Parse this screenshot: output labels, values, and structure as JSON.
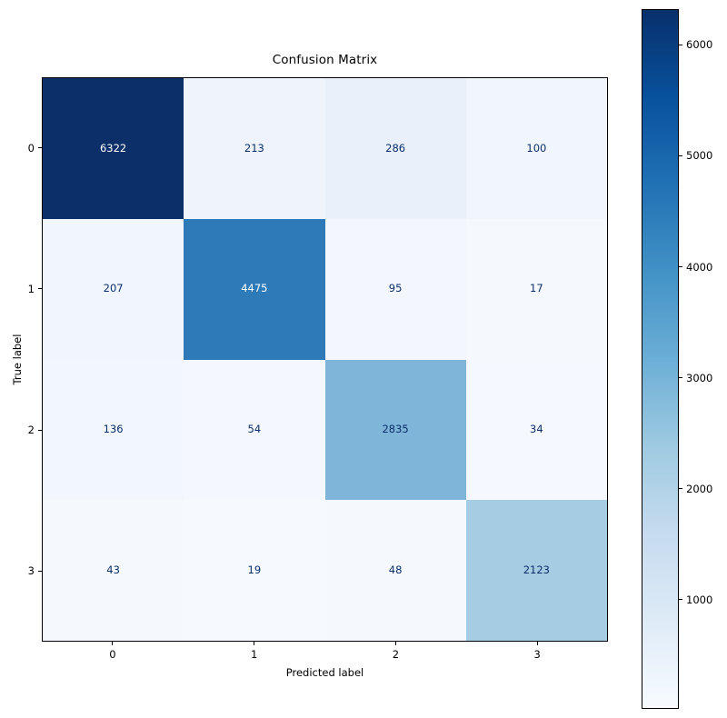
{
  "chart_data": {
    "type": "heatmap",
    "title": "Confusion Matrix",
    "xlabel": "Predicted label",
    "ylabel": "True label",
    "x_tick_labels": [
      "0",
      "1",
      "2",
      "3"
    ],
    "y_tick_labels": [
      "0",
      "1",
      "2",
      "3"
    ],
    "categories": [
      "0",
      "1",
      "2",
      "3"
    ],
    "matrix": [
      [
        6322,
        213,
        286,
        100
      ],
      [
        207,
        4475,
        95,
        17
      ],
      [
        136,
        54,
        2835,
        34
      ],
      [
        43,
        19,
        48,
        2123
      ]
    ],
    "cell_labels": [
      [
        "6322",
        "213",
        "286",
        "100"
      ],
      [
        "207",
        "4475",
        "95",
        "17"
      ],
      [
        "136",
        "54",
        "2835",
        "34"
      ],
      [
        "43",
        "19",
        "48",
        "2123"
      ]
    ],
    "colormap": "Blues",
    "vmin": 17,
    "vmax": 6322,
    "grid": false,
    "legend_position": "right-colorbar",
    "colorbar": {
      "ticks": [
        6000,
        5000,
        4000,
        3000,
        2000,
        1000
      ],
      "tick_labels": [
        "6000",
        "5000",
        "4000",
        "3000",
        "2000",
        "1000"
      ],
      "orientation": "vertical",
      "range_min": 17,
      "range_max": 6322
    },
    "colors": {
      "cmap_low": "#f7fbff",
      "cmap_mid": "#4292c6",
      "cmap_high": "#08306b",
      "text_dark": "#0b2f6b",
      "text_light": "#ffffff",
      "axes_edge": "#000000",
      "background": "#ffffff"
    },
    "cell_colors": [
      [
        "#0c2f69",
        "#eff4fc",
        "#e9f0fa",
        "#f1f6fd"
      ],
      [
        "#f1f5fd",
        "#2e7ab8",
        "#f3f7fd",
        "#f5f9fe"
      ],
      [
        "#f2f6fd",
        "#f4f8fe",
        "#7fb5d8",
        "#f5f8fe"
      ],
      [
        "#f5f9fe",
        "#f6f9fe",
        "#f5f9fe",
        "#a6cce4"
      ]
    ],
    "cell_text_colors": [
      [
        "#ffffff",
        "#0b2f6b",
        "#0b2f6b",
        "#0b2f6b"
      ],
      [
        "#0b2f6b",
        "#ffffff",
        "#0b2f6b",
        "#0b2f6b"
      ],
      [
        "#0b2f6b",
        "#0b2f6b",
        "#0b2f6b",
        "#0b2f6b"
      ],
      [
        "#0b2f6b",
        "#0b2f6b",
        "#0b2f6b",
        "#0b2f6b"
      ]
    ]
  }
}
